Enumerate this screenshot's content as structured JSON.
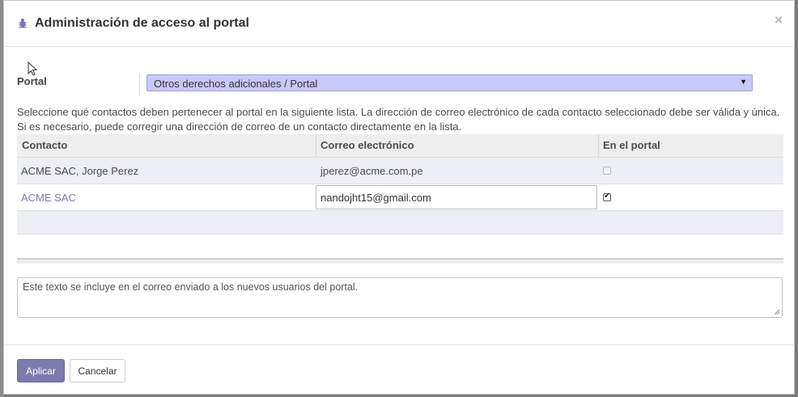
{
  "dialog": {
    "title": "Administración de acceso al portal",
    "close_glyph": "×",
    "icon": "bug-icon"
  },
  "portal": {
    "label": "Portal",
    "selected": "Otros derechos adicionales / Portal"
  },
  "help_text": {
    "line1": "Seleccione qué contactos deben pertenecer al portal en la siguiente lista. La dirección de correo electrónico de cada contacto seleccionado debe ser válida y única.",
    "line2": "Si es necesario, puede corregir una dirección de correo de un contacto directamente en la lista."
  },
  "table": {
    "columns": [
      "Contacto",
      "Correo electrónico",
      "En el portal"
    ],
    "rows": [
      {
        "contact": "ACME SAC, Jorge Perez",
        "email": "jperez@acme.com.pe",
        "in_portal": false
      },
      {
        "contact": "ACME SAC",
        "email": "nandojht15@gmail.com",
        "in_portal": true
      }
    ]
  },
  "note": {
    "value": "Este texto se incluye en el correo enviado a los nuevos usuarios del portal."
  },
  "buttons": {
    "apply": "Aplicar",
    "cancel": "Cancelar"
  },
  "colors": {
    "primary": "#7c7bad",
    "select_bg": "#c9c9f7"
  }
}
